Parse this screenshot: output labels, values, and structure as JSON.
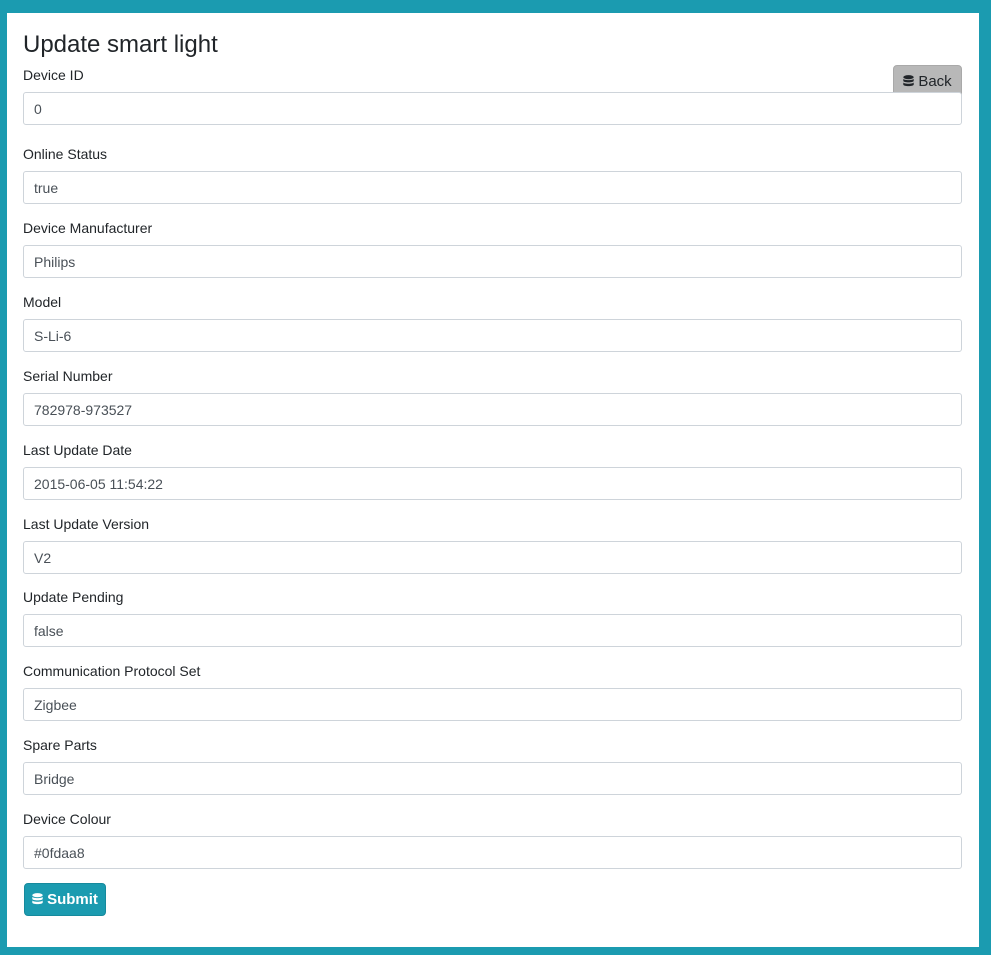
{
  "page": {
    "title": "Update smart light"
  },
  "toolbar": {
    "back_label": "Back",
    "back_icon": "database-icon"
  },
  "form": {
    "fields": [
      {
        "label": "Device ID",
        "value": "0"
      },
      {
        "label": "Online Status",
        "value": "true"
      },
      {
        "label": "Device Manufacturer",
        "value": "Philips"
      },
      {
        "label": "Model",
        "value": "S-Li-6"
      },
      {
        "label": "Serial Number",
        "value": "782978-973527"
      },
      {
        "label": "Last Update Date",
        "value": "2015-06-05 11:54:22"
      },
      {
        "label": "Last Update Version",
        "value": "V2"
      },
      {
        "label": "Update Pending",
        "value": "false"
      },
      {
        "label": "Communication Protocol Set",
        "value": "Zigbee"
      },
      {
        "label": "Spare Parts",
        "value": "Bridge"
      },
      {
        "label": "Device Colour",
        "value": "#0fdaa8"
      }
    ],
    "submit_label": "Submit",
    "submit_icon": "database-icon"
  },
  "colors": {
    "page_background": "#1b9bb0",
    "primary_button": "#1b9bb0",
    "secondary_button": "#b8b8b8"
  }
}
